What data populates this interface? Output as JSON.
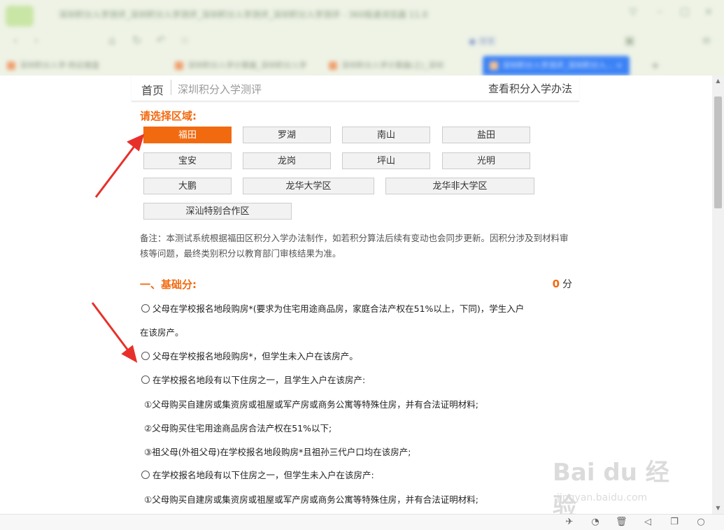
{
  "browser": {
    "title_text": "深圳积分入学测评_深圳积分入学测评_深圳积分入学测评_深圳积分入学测评 - 360极速浏览器 11.0",
    "address_text": "",
    "search_text": "搜索",
    "tabs": [
      {
        "label": "深圳积分入学-附近楼盘"
      },
      {
        "label": "深圳积分入学计算器_深圳积分入学"
      },
      {
        "label": "深圳积分入学计算器(之)_深圳"
      },
      {
        "label": "深圳积分入学测评_深圳积分入..."
      }
    ],
    "new_tab": "+"
  },
  "header": {
    "home": "首页",
    "current": "深圳积分入学测评",
    "right_link": "查看积分入学办法"
  },
  "region": {
    "label": "请选择区域:",
    "buttons": [
      "福田",
      "罗湖",
      "南山",
      "盐田",
      "宝安",
      "龙岗",
      "坪山",
      "光明",
      "大鹏",
      "龙华大学区",
      "龙华非大学区",
      "深汕特别合作区"
    ],
    "selected": "福田"
  },
  "remark": "备注：本测试系统根据福田区积分入学办法制作，如若积分算法后续有变动也会同步更新。因积分涉及到材料审核等问题，最终类别积分以教育部门审核结果为准。",
  "basic": {
    "heading": "一、基础分:",
    "score": "0",
    "unit": "分",
    "options": [
      "父母在学校报名地段购房*(要求为住宅用途商品房，家庭合法产权在51%以上，下同)，学生入户",
      "在该房产。",
      "父母在学校报名地段购房*，但学生未入户在该房产。",
      "在学校报名地段有以下住房之一，且学生入户在该房产:",
      "①父母购买自建房或集资房或祖屋或军产房或商务公寓等特殊住房，并有合法证明材料;",
      "②父母购买住宅用途商品房合法产权在51%以下;",
      "③祖父母(外祖父母)在学校报名地段购房*且祖孙三代户口均在该房产;",
      "在学校报名地段有以下住房之一，但学生未入户在该房产:",
      "①父母购买自建房或集资房或祖屋或军产房或商务公寓等特殊住房，并有合法证明材料;"
    ]
  },
  "watermark": {
    "brand": "Bai du 经验",
    "url": "jingyan.baidu.com"
  },
  "colors": {
    "accent": "#f26a10",
    "arrow": "#e8302a"
  }
}
